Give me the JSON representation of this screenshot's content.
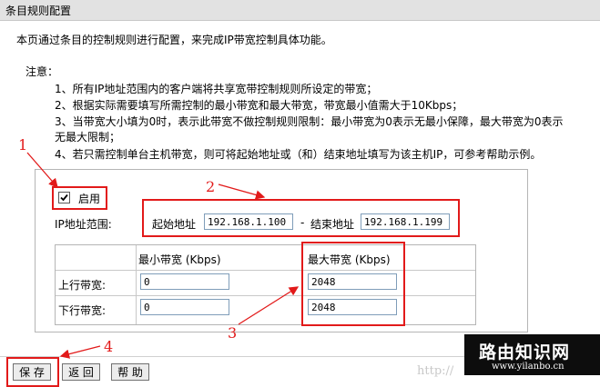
{
  "title": "条目规则配置",
  "intro": "本页通过条目的控制规则进行配置，来完成IP带宽控制具体功能。",
  "notes_title": "注意：",
  "notes": [
    "1、所有IP地址范围内的客户端将共享宽带控制规则所设定的带宽；",
    "2、根据实际需要填写所需控制的最小带宽和最大带宽，带宽最小值需大于10Kbps；",
    "3、当带宽大小填为0时，表示此带宽不做控制规则限制：最小带宽为0表示无最小保障，最大带宽为0表示",
    "无最大限制；",
    "4、若只需控制单台主机带宽，则可将起始地址或（和）结束地址填写为该主机IP，可参考帮助示例。"
  ],
  "enable": {
    "label": "启用",
    "checked": true
  },
  "ip_range": {
    "label": "IP地址范围:",
    "start_label": "起始地址",
    "start_value": "192.168.1.100",
    "separator": "-",
    "end_label": "结束地址",
    "end_value": "192.168.1.199"
  },
  "bandwidth_table": {
    "col_min": "最小带宽 (Kbps)",
    "col_max": "最大带宽 (Kbps)",
    "rows": [
      {
        "label": "上行带宽:",
        "min": "0",
        "max": "2048"
      },
      {
        "label": "下行带宽:",
        "min": "0",
        "max": "2048"
      }
    ]
  },
  "buttons": {
    "save": "保 存",
    "back": "返 回",
    "help": "帮 助"
  },
  "annotations": [
    "1",
    "2",
    "3",
    "4"
  ],
  "watermark": {
    "title": "路由知识网",
    "url": "www.yilanbo.cn",
    "partial_url": "http://"
  },
  "colors": {
    "annotation_red": "#e21a1a",
    "title_bar": "#e2e2e2"
  }
}
